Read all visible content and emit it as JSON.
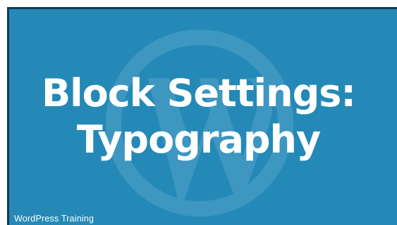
{
  "slide": {
    "title_line1": "Block Settings:",
    "title_line2": "Typography",
    "footer_label": "WordPress Training",
    "watermark_icon": "wordpress-logo-icon",
    "background_color": "#2489b6",
    "text_color": "#ffffff"
  }
}
